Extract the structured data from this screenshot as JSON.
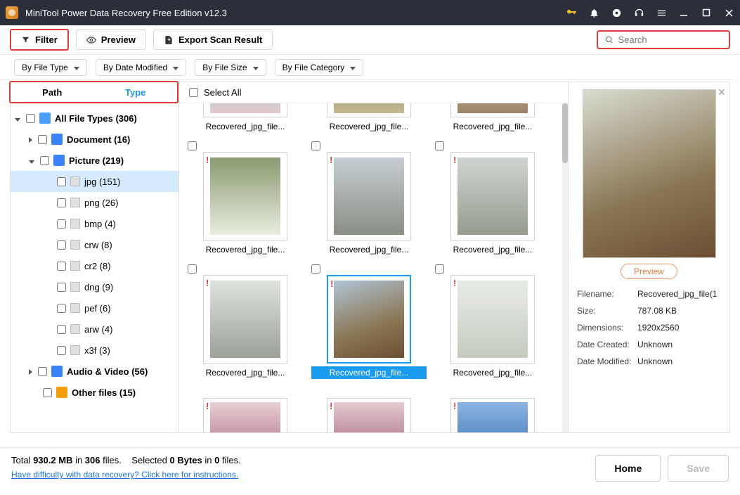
{
  "titlebar": {
    "title": "MiniTool Power Data Recovery Free Edition v12.3"
  },
  "toolbar": {
    "filter": "Filter",
    "preview": "Preview",
    "export": "Export Scan Result",
    "search_placeholder": "Search"
  },
  "chips": {
    "fileType": "By File Type",
    "dateModified": "By Date Modified",
    "fileSize": "By File Size",
    "fileCategory": "By File Category"
  },
  "tabs": {
    "path": "Path",
    "type": "Type"
  },
  "tree": {
    "all": "All File Types (306)",
    "document": "Document (16)",
    "picture": "Picture (219)",
    "jpg": "jpg (151)",
    "png": "png (26)",
    "bmp": "bmp (4)",
    "crw": "crw (8)",
    "cr2": "cr2 (8)",
    "dng": "dng (9)",
    "pef": "pef (6)",
    "arw": "arw (4)",
    "x3f": "x3f (3)",
    "audio": "Audio & Video (56)",
    "other": "Other files (15)"
  },
  "selectAll": "Select All",
  "grid": {
    "f1": "Recovered_jpg_file...",
    "f2": "Recovered_jpg_file...",
    "f3": "Recovered_jpg_file...",
    "f4": "Recovered_jpg_file...",
    "f5": "Recovered_jpg_file...",
    "f6": "Recovered_jpg_file...",
    "f7": "Recovered_jpg_file...",
    "f8_sel": "Recovered_jpg_file...",
    "f9": "Recovered_jpg_file..."
  },
  "preview": {
    "btn": "Preview",
    "k_filename": "Filename:",
    "v_filename": "Recovered_jpg_file(1",
    "k_size": "Size:",
    "v_size": "787.08 KB",
    "k_dim": "Dimensions:",
    "v_dim": "1920x2560",
    "k_created": "Date Created:",
    "v_created": "Unknown",
    "k_modified": "Date Modified:",
    "v_modified": "Unknown"
  },
  "bottom": {
    "total_prefix": "Total ",
    "total_size": "930.2 MB",
    "in": " in ",
    "total_files": "306",
    "files_suffix": " files.",
    "sel_prefix": "Selected ",
    "sel_bytes": "0 Bytes",
    "sel_in": " in ",
    "sel_count": "0",
    "sel_suffix": " files.",
    "help": "Have difficulty with data recovery? Click here for instructions.",
    "home": "Home",
    "save": "Save"
  }
}
